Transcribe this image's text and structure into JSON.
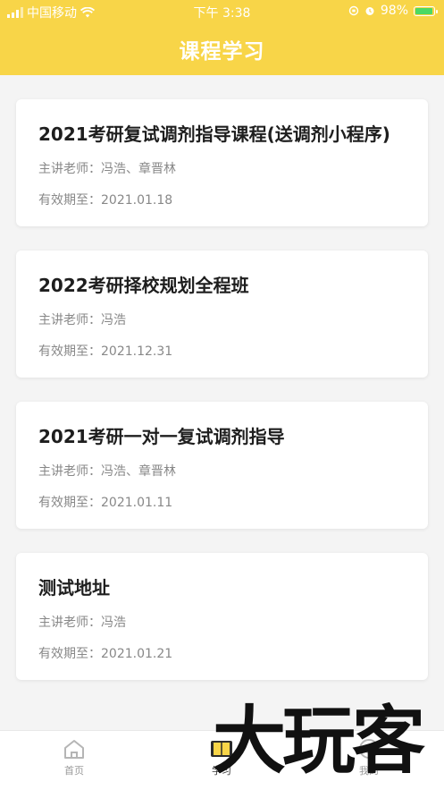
{
  "status_bar": {
    "carrier": "中国移动",
    "time": "下午 3:38",
    "battery": "98%"
  },
  "header": {
    "title": "课程学习",
    "background_color": "#f8d548"
  },
  "courses": [
    {
      "title": "2021考研复试调剂指导课程(送调剂小程序)",
      "teacher": "主讲老师：冯浩、章晋林",
      "expiry": "有效期至：2021.01.18"
    },
    {
      "title": "2022考研择校规划全程班",
      "teacher": "主讲老师：冯浩",
      "expiry": "有效期至：2021.12.31"
    },
    {
      "title": "2021考研一对一复试调剂指导",
      "teacher": "主讲老师：冯浩、章晋林",
      "expiry": "有效期至：2021.01.11"
    },
    {
      "title": "测试地址",
      "teacher": "主讲老师：冯浩",
      "expiry": "有效期至：2021.01.21"
    }
  ],
  "tab_bar": {
    "tabs": [
      {
        "label": "首页",
        "icon": "home-icon",
        "active": false
      },
      {
        "label": "学习",
        "icon": "book-icon",
        "active": true
      },
      {
        "label": "我的",
        "icon": "user-icon",
        "active": false
      }
    ]
  },
  "watermark": {
    "text": "大玩客"
  }
}
